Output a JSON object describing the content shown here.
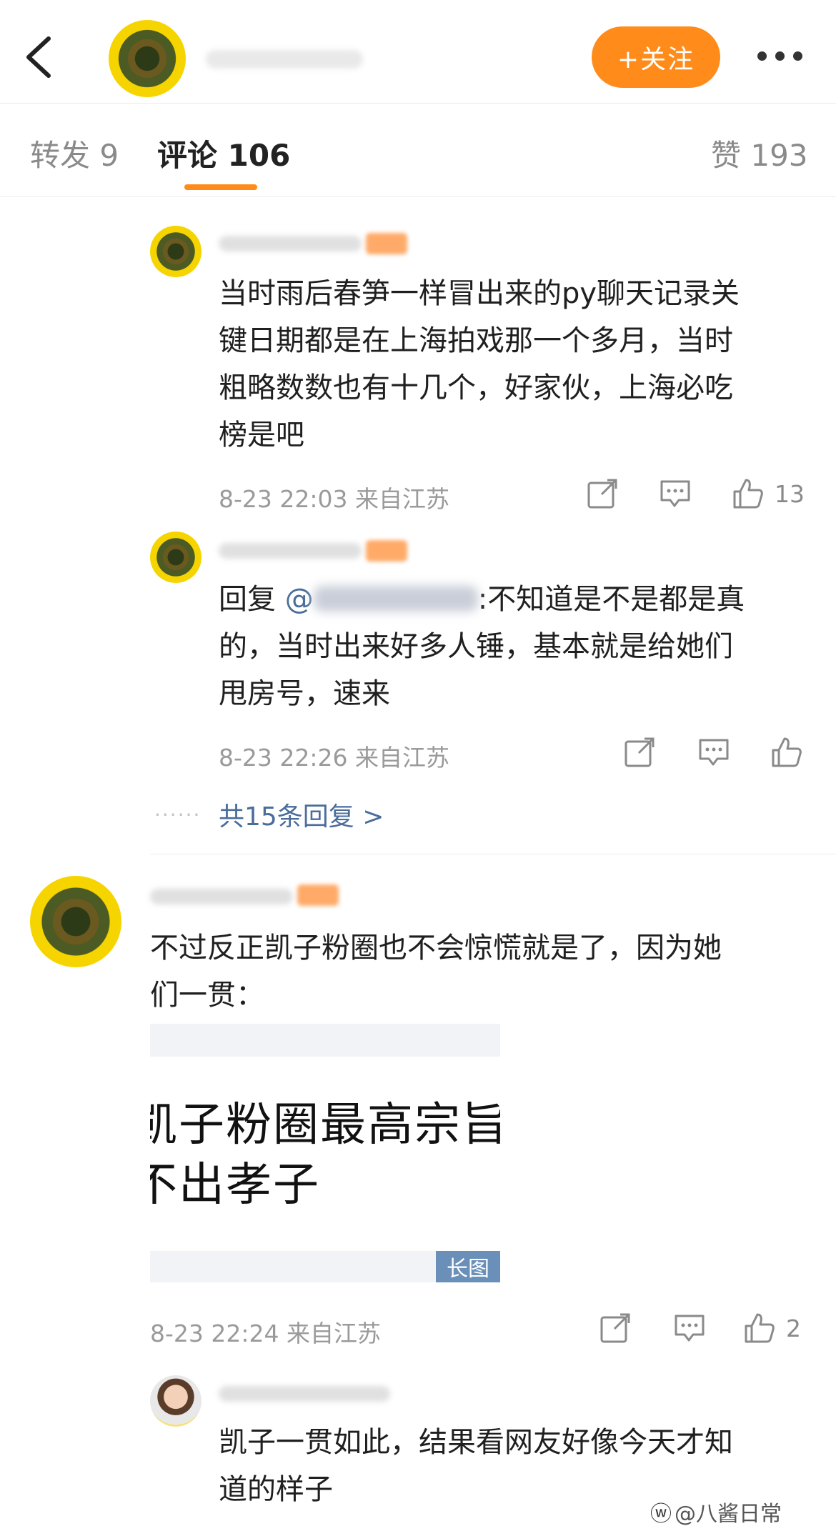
{
  "header": {
    "follow_label": "+关注"
  },
  "tabs": [
    {
      "label": "转发 9"
    },
    {
      "label": "评论 106"
    },
    {
      "label": "赞 193"
    }
  ],
  "comments": [
    {
      "text": "当时雨后春笋一样冒出来的py聊天记录关键日期都是在上海拍戏那一个多月，当时粗略数数也有十几个，好家伙，上海必吃榜是吧",
      "lines": [
        "当时雨后春笋一样冒出来的py聊天记录关",
        "键日期都是在上海拍戏那一个多月，当时",
        "粗略数数也有十几个，好家伙，上海必吃",
        "榜是吧"
      ],
      "meta": "8-23 22:03  来自江苏",
      "likes": "13"
    },
    {
      "reply_prefix": "回复",
      "mention": "@",
      "text_after_mention": ":不知道是不是都是真",
      "lines": [
        "的，当时出来好多人锤，基本就是给她们",
        "甩房号，速来"
      ],
      "meta": "8-23 22:26  来自江苏"
    }
  ],
  "replies_link": "共15条回复 >",
  "dots": "······",
  "comment2": {
    "lines": [
      "不过反正凯子粉圈也不会惊慌就是了，因为她",
      "们一贯："
    ],
    "image_lines": [
      "凯子粉圈最高宗旨",
      "不出孝子"
    ],
    "image_tag": "长图",
    "meta": "8-23 22:24  来自江苏",
    "likes": "2"
  },
  "sub_reply": {
    "lines": [
      "凯子一贯如此，结果看网友好像今天才知",
      "道的样子"
    ]
  },
  "watermark": "@八酱日常",
  "colors": {
    "accent": "#ff8b1a",
    "link": "#4a6d9c"
  }
}
